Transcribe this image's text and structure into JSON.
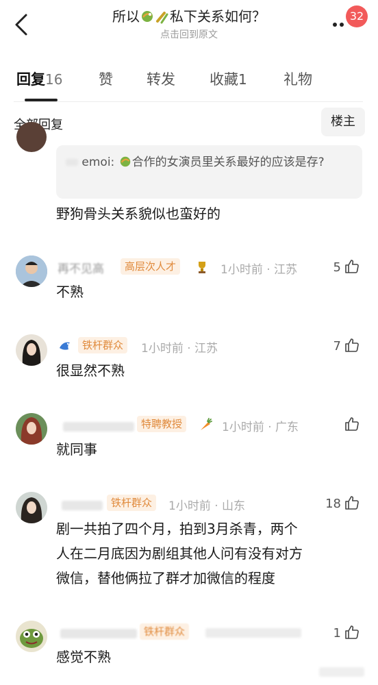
{
  "header": {
    "title_prefix": "所以",
    "title_suffix": "私下关系如何？",
    "subtitle": "点击回到原文",
    "notification_count": "32"
  },
  "tabs": [
    {
      "label": "回复",
      "count": "16"
    },
    {
      "label": "赞",
      "count": ""
    },
    {
      "label": "转发",
      "count": ""
    },
    {
      "label": "收藏",
      "count": "1"
    },
    {
      "label": "礼物",
      "count": ""
    }
  ],
  "filter": {
    "label": "全部回复",
    "op_button": "楼主"
  },
  "quote": {
    "name": "emoi:",
    "text": "合作的女演员里关系最好的应该是存?",
    "reply": "野狗骨头关系貌似也蛮好的"
  },
  "comments": [
    {
      "nick": "再不见高",
      "tag": "高层次人才",
      "meta": "1小时前 · 江苏",
      "likes": "5",
      "text": "不熟"
    },
    {
      "nick": "",
      "tag": "铁杆群众",
      "meta": "1小时前 · 江苏",
      "likes": "7",
      "text": "很显然不熟"
    },
    {
      "nick": "",
      "tag": "特聘教授",
      "meta": "1小时前 · 广东",
      "likes": "",
      "text": "就同事"
    },
    {
      "nick": "",
      "tag": "铁杆群众",
      "meta": "1小时前 · 山东",
      "likes": "18",
      "text_lines": [
        "剧一共拍了四个月，拍到3月杀青，两个",
        "人在二月底因为剧组其他人问有没有对方",
        "微信，替他俩拉了群才加微信的程度"
      ]
    },
    {
      "nick": "",
      "tag": "铁杆群众",
      "meta": "",
      "likes": "1",
      "text": "感觉不熟"
    }
  ],
  "colors": {
    "badge": "#f25a5a",
    "tag_bg": "#fdf0e3",
    "tag_text": "#e08a3c",
    "accent": "#222222"
  }
}
